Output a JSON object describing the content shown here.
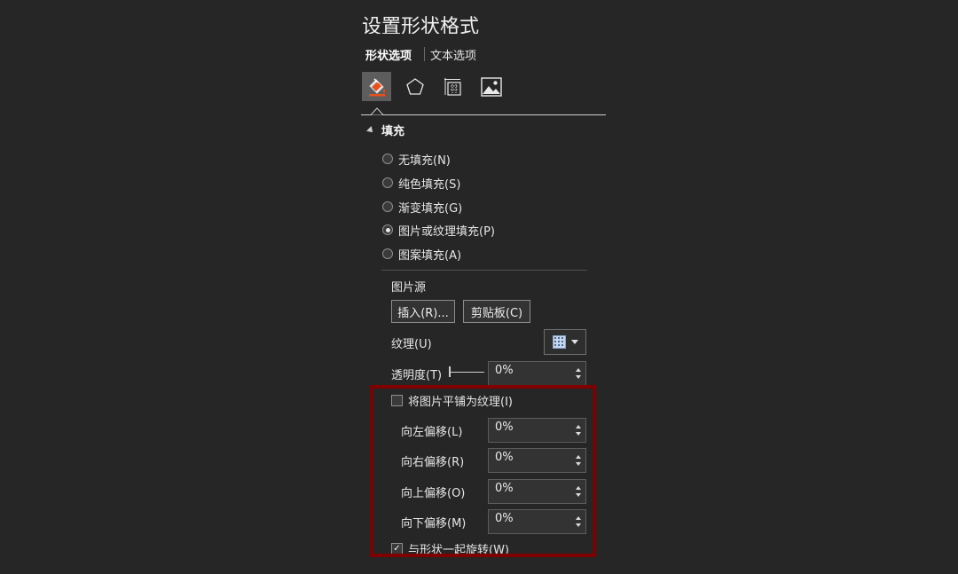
{
  "panel": {
    "title": "设置形状格式"
  },
  "tabs": [
    {
      "label": "形状选项",
      "active": true
    },
    {
      "label": "文本选项",
      "active": false
    }
  ],
  "icon_tabs": [
    {
      "icon": "fill-line-icon",
      "active": true
    },
    {
      "icon": "effects-pentagon-icon",
      "active": false
    },
    {
      "icon": "size-properties-icon",
      "active": false
    },
    {
      "icon": "picture-icon",
      "active": false
    }
  ],
  "fill_section": {
    "title": "填充",
    "options": [
      {
        "label": "无填充(N)",
        "selected": false
      },
      {
        "label": "纯色填充(S)",
        "selected": false
      },
      {
        "label": "渐变填充(G)",
        "selected": false
      },
      {
        "label": "图片或纹理填充(P)",
        "selected": true
      },
      {
        "label": "图案填充(A)",
        "selected": false
      }
    ],
    "picture_source_label": "图片源",
    "insert_button": "插入(R)...",
    "clipboard_button": "剪贴板(C)",
    "texture_label": "纹理(U)",
    "texture_icon": "texture-swatch-icon",
    "transparency_label": "透明度(T)",
    "transparency_value": "0%",
    "transparency_fraction": 0,
    "tile_checkbox": {
      "label": "将图片平铺为纹理(I)",
      "checked": false
    },
    "offsets": [
      {
        "label": "向左偏移(L)",
        "value": "0%"
      },
      {
        "label": "向右偏移(R)",
        "value": "0%"
      },
      {
        "label": "向上偏移(O)",
        "value": "0%"
      },
      {
        "label": "向下偏移(M)",
        "value": "0%"
      }
    ],
    "rotate_checkbox": {
      "label": "与形状一起旋转(W)",
      "checked": true,
      "mark": "✓"
    }
  },
  "colors": {
    "background": "#262626",
    "highlight_border": "#800000",
    "fill_icon_accent": "#e8501e"
  }
}
